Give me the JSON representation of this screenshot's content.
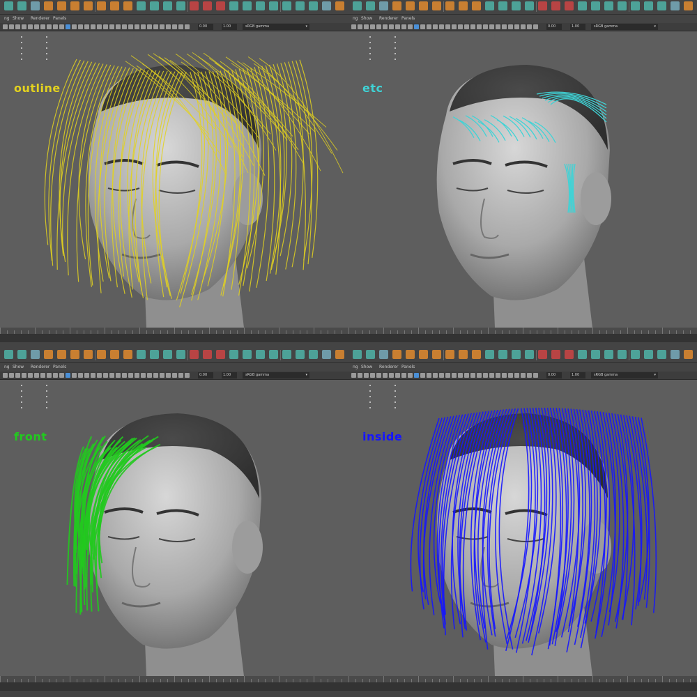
{
  "app": {
    "colors": {
      "panel_bg": "#5e5e5e",
      "toolbar_bg": "#444444",
      "icon_teal": "#4fb3a7",
      "icon_orange": "#e08a2e"
    }
  },
  "menu": {
    "items": [
      "ng",
      "Show",
      "Renderer",
      "Panels"
    ]
  },
  "panel_toolbar": {
    "field_a": "0.00",
    "field_b": "1.00",
    "color_space": "sRGB gamma"
  },
  "viewports": [
    {
      "label": "outline",
      "color": "#e3d21f"
    },
    {
      "label": "etc",
      "color": "#3fd3d6"
    },
    {
      "label": "front",
      "color": "#22c91f"
    },
    {
      "label": "inside",
      "color": "#1515ff"
    }
  ]
}
